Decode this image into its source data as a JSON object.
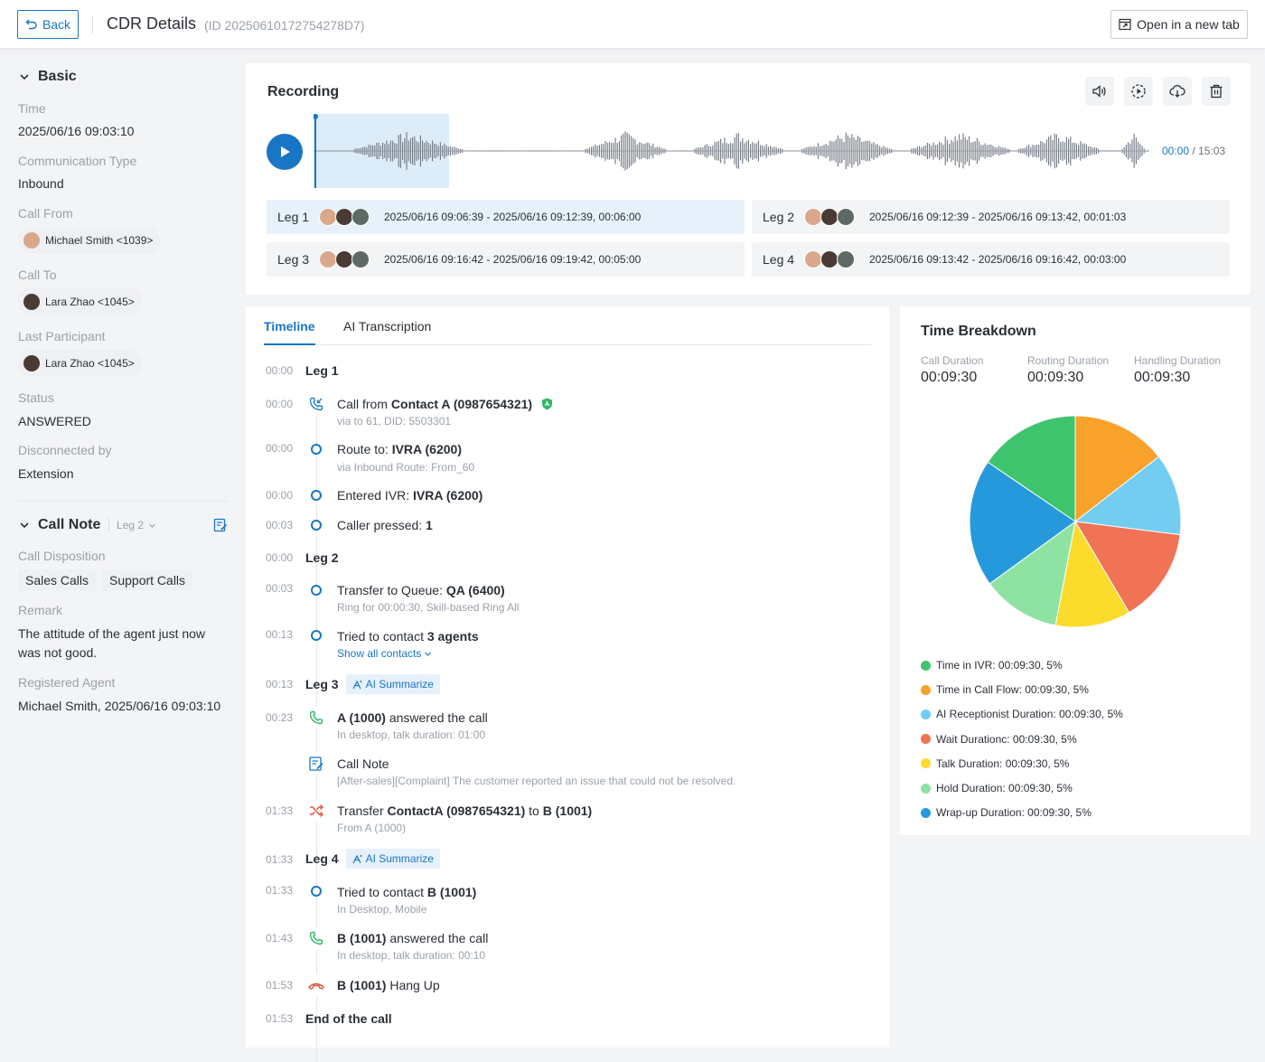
{
  "header": {
    "back_label": "Back",
    "title": "CDR Details",
    "id_text": "(ID 20250610172754278D7)",
    "open_tab_label": "Open in a new tab"
  },
  "basic": {
    "heading": "Basic",
    "time_label": "Time",
    "time_value": "2025/06/16 09:03:10",
    "comm_type_label": "Communication Type",
    "comm_type_value": "Inbound",
    "call_from_label": "Call From",
    "call_from_value": "Michael Smith <1039>",
    "call_to_label": "Call To",
    "call_to_value": "Lara Zhao <1045>",
    "last_participant_label": "Last Participant",
    "last_participant_value": "Lara Zhao <1045>",
    "status_label": "Status",
    "status_value": "ANSWERED",
    "disconnected_label": "Disconnected by",
    "disconnected_value": "Extension"
  },
  "call_note": {
    "heading": "Call Note",
    "leg_select": "Leg 2",
    "disposition_label": "Call Disposition",
    "dispositions": [
      "Sales Calls",
      "Support Calls"
    ],
    "remark_label": "Remark",
    "remark_line1": "The attitude of the agent just now",
    "remark_line2": "was not good.",
    "registered_label": "Registered Agent",
    "registered_value": "Michael Smith, 2025/06/16 09:03:10"
  },
  "recording": {
    "title": "Recording",
    "current_time": "00:00",
    "total_time": "/ 15:03",
    "progress": 0,
    "legs": [
      {
        "name": "Leg 1",
        "range": "2025/06/16 09:06:39 - 2025/06/16 09:12:39, 00:06:00",
        "active": true
      },
      {
        "name": "Leg 2",
        "range": "2025/06/16 09:12:39 - 2025/06/16 09:13:42, 00:01:03",
        "active": false
      },
      {
        "name": "Leg 3",
        "range": "2025/06/16 09:16:42 - 2025/06/16 09:19:42, 00:05:00",
        "active": false
      },
      {
        "name": "Leg 4",
        "range": "2025/06/16 09:13:42 - 2025/06/16 09:16:42, 00:03:00",
        "active": false
      }
    ]
  },
  "timeline": {
    "tab_timeline": "Timeline",
    "tab_transcription": "AI Transcription",
    "ai_summarize": "AI Summarize",
    "leg1": {
      "ts": "00:00",
      "label": "Leg 1"
    },
    "e1": {
      "ts": "00:00",
      "pre": "Call from ",
      "bold": "Contact A (0987654321)",
      "sub": "via to 61, DID: 5503301"
    },
    "e2": {
      "ts": "00:00",
      "pre": "Route to: ",
      "bold": "IVRA (6200)",
      "sub": "via Inbound Route: From_60"
    },
    "e3": {
      "ts": "00:00",
      "pre": "Entered IVR: ",
      "bold": "IVRA (6200)"
    },
    "e4": {
      "ts": "00:03",
      "pre": "Caller pressed: ",
      "bold": "1"
    },
    "leg2": {
      "ts": "00:00",
      "label": "Leg 2"
    },
    "e5": {
      "ts": "00:03",
      "pre": "Transfer to Queue: ",
      "bold": "QA (6400)",
      "sub": "Ring for 00:00:30, Skill-based Ring All"
    },
    "e6": {
      "ts": "00:13",
      "pre": "Tried to contact ",
      "bold": "3 agents",
      "link": "Show all contacts"
    },
    "leg3": {
      "ts": "00:13",
      "label": "Leg 3"
    },
    "e7": {
      "ts": "00:23",
      "bold": "A (1000)",
      "post": " answered the call",
      "sub": "In desktop, talk duration: 01:00"
    },
    "e8": {
      "title": "Call Note",
      "sub": "[After-sales][Complaint] The customer reported an issue that could not be resolved."
    },
    "e9": {
      "ts": "01:33",
      "pre": "Transfer ",
      "bold": "ContactA (0987654321)",
      "mid": " to ",
      "bold2": "B (1001)",
      "sub": "From A (1000)"
    },
    "leg4": {
      "ts": "01:33",
      "label": "Leg 4"
    },
    "e10": {
      "ts": "01:33",
      "pre": "Tried to contact ",
      "bold": "B (1001)",
      "sub": "In Desktop, Mobile"
    },
    "e11": {
      "ts": "01:43",
      "bold": "B (1001)",
      "post": " answered the call",
      "sub": "In desktop, talk duration: 00:10"
    },
    "e12": {
      "ts": "01:53",
      "bold": "B (1001)",
      "post": " Hang Up"
    },
    "end": {
      "ts": "01:53",
      "label": "End of the call"
    }
  },
  "breakdown": {
    "title": "Time Breakdown",
    "durations": [
      {
        "label": "Call Duration",
        "value": "00:09:30"
      },
      {
        "label": "Routing Duration",
        "value": "00:09:30"
      },
      {
        "label": "Handling Duration",
        "value": "00:09:30"
      }
    ]
  },
  "chart_data": {
    "type": "pie",
    "legend_position": "bottom",
    "slices": [
      {
        "name": "Time in Call Flow",
        "label": "Time in Call Flow:  00:09:30, 5%",
        "value": 14.5,
        "color": "#f8a12b"
      },
      {
        "name": "AI Receptionist Duration",
        "label": "AI Receptionist Duration:  00:09:30, 5%",
        "value": 12.5,
        "color": "#72cdf0"
      },
      {
        "name": "Wait Durationc",
        "label": "Wait Durationc:  00:09:30, 5%",
        "value": 14.5,
        "color": "#f07355"
      },
      {
        "name": "Talk Duration",
        "label": "Talk Duration:  00:09:30, 5%",
        "value": 11.5,
        "color": "#fbdb2b"
      },
      {
        "name": "Hold Duration",
        "label": "Hold Duration:  00:09:30, 5%",
        "value": 12,
        "color": "#8ee3a3"
      },
      {
        "name": "Wrap-up Duration",
        "label": "Wrap-up Duration:  00:09:30, 5%",
        "value": 19.5,
        "color": "#2599db"
      },
      {
        "name": "Time in IVR",
        "label": "Time in IVR:  00:09:30, 5%",
        "value": 15.5,
        "color": "#3ec46d"
      }
    ],
    "legend_order": [
      6,
      0,
      1,
      2,
      3,
      4,
      5
    ]
  },
  "colors": {
    "accent": "#1976c5",
    "green": "#2fb866",
    "red": "#e2553b"
  }
}
